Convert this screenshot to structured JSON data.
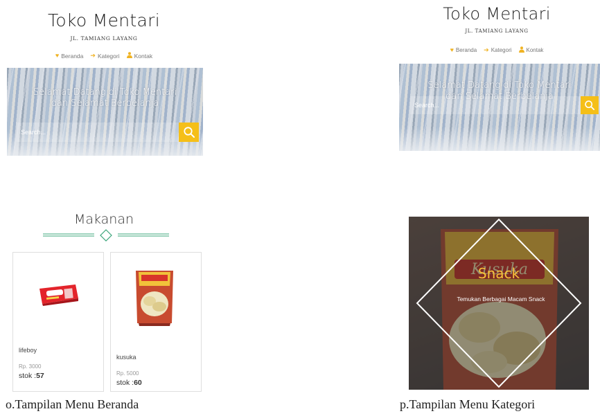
{
  "colors": {
    "accent": "#f5bf18",
    "divider_green": "#3aa57a",
    "text_dark": "#222222"
  },
  "home_screen": {
    "store_name": "Toko Mentari",
    "store_address": "JL. TAMIANG LAYANG",
    "nav": [
      {
        "label": "Beranda",
        "icon": "heart-icon"
      },
      {
        "label": "Kategori",
        "icon": "arrow-right-icon"
      },
      {
        "label": "Kontak",
        "icon": "user-icon"
      }
    ],
    "hero": {
      "line1": "Selamat Datang di Toko Mentari",
      "line2": "dan Selamat Berbelanja"
    },
    "search": {
      "placeholder": "Search...",
      "icon": "search-icon"
    },
    "section_title": "Makanan",
    "products": [
      {
        "name": "lifeboy",
        "price": "Rp. 3000",
        "stock_label": "stok :",
        "stock_value": "57"
      },
      {
        "name": "kusuka",
        "price": "Rp. 5000",
        "stock_label": "stok :",
        "stock_value": "60"
      }
    ]
  },
  "category_screen": {
    "store_name": "Toko Mentari",
    "store_address": "JL. TAMIANG LAYANG",
    "nav": [
      {
        "label": "Beranda",
        "icon": "heart-icon"
      },
      {
        "label": "Kategori",
        "icon": "arrow-right-icon"
      },
      {
        "label": "Kontak",
        "icon": "user-icon"
      }
    ],
    "hero": {
      "line1": "Selamat Datang di Toko Mentari",
      "line2": "dan Selamat Berbelanja"
    },
    "search": {
      "placeholder": "Search...",
      "icon": "search-icon"
    },
    "category": {
      "title": "Snack",
      "description": "Temukan Berbagai Macam Snack",
      "package_brand": "Kusuka"
    }
  },
  "captions": {
    "left": "o.Tampilan Menu Beranda",
    "right": "p.Tampilan Menu Kategori"
  }
}
